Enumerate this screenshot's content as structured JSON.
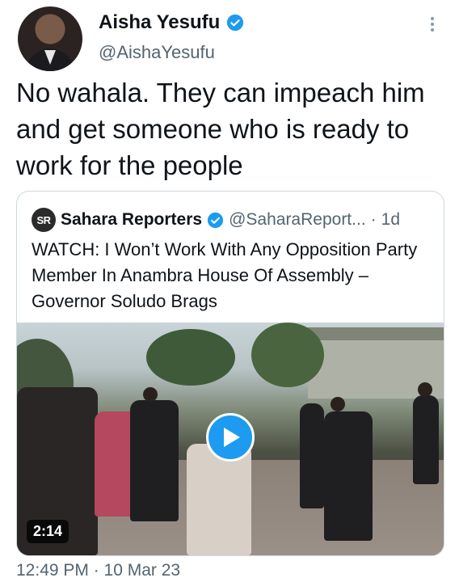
{
  "author": {
    "name": "Aisha Yesufu",
    "handle": "@AishaYesufu",
    "verified_icon": "verified-badge-icon"
  },
  "tweet": {
    "text": "No wahala. They can impeach him and get someone who is ready to work for the people",
    "timestamp": "12:49 PM · 10 Mar 23"
  },
  "quote": {
    "logo_text": "SR",
    "name": "Sahara Reporters",
    "handle": "@SaharaReport...",
    "separator": "·",
    "time": "1d",
    "text": "WATCH: I Won’t Work With Any Opposition Party Member In Anambra House Of Assembly – Governor Soludo Brags",
    "video": {
      "duration": "2:14",
      "play_icon": "play-icon"
    }
  },
  "colors": {
    "accent": "#1d9bf0",
    "text": "#0f1419",
    "secondary": "#536471",
    "border": "#cfd9de"
  }
}
